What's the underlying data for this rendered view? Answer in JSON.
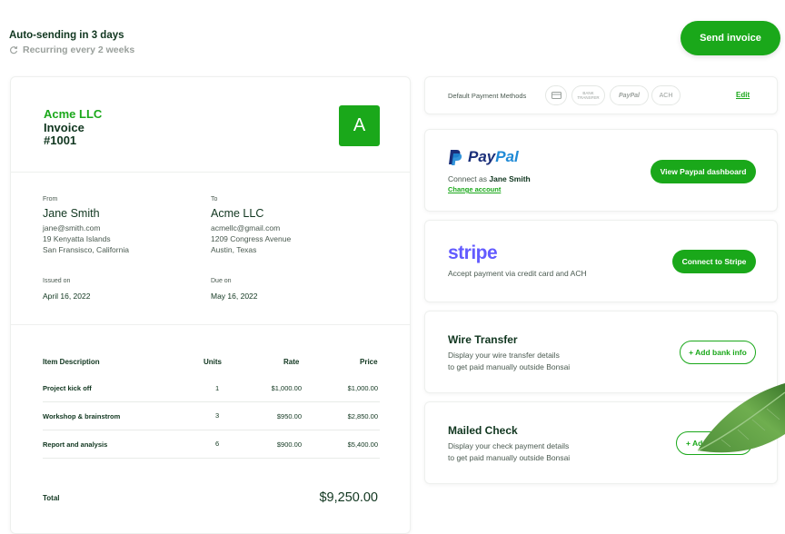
{
  "header": {
    "title": "Auto-sending in 3 days",
    "subtitle": "Recurring every 2 weeks",
    "send_button": "Send invoice"
  },
  "invoice": {
    "company": "Acme LLC",
    "label": "Invoice",
    "number": "#1001",
    "logo_letter": "A",
    "from": {
      "label": "From",
      "name": "Jane Smith",
      "email": "jane@smith.com",
      "address1": "19 Kenyatta Islands",
      "address2": "San Fransisco, California"
    },
    "to": {
      "label": "To",
      "name": "Acme LLC",
      "email": "acmellc@gmail.com",
      "address1": "1209 Congress Avenue",
      "address2": "Austin, Texas"
    },
    "issued": {
      "label": "Issued on",
      "date": "April 16, 2022"
    },
    "due": {
      "label": "Due on",
      "date": "May 16, 2022"
    },
    "table": {
      "headers": [
        "Item Description",
        "Units",
        "Rate",
        "Price"
      ],
      "rows": [
        {
          "description": "Project kick off",
          "units": "1",
          "rate": "$1,000.00",
          "price": "$1,000.00"
        },
        {
          "description": "Workshop & brainstrom",
          "units": "3",
          "rate": "$950.00",
          "price": "$2,850.00"
        },
        {
          "description": "Report and analysis",
          "units": "6",
          "rate": "$900.00",
          "price": "$5,400.00"
        }
      ]
    },
    "total_label": "Total",
    "total_value": "$9,250.00"
  },
  "payment_methods": {
    "label": "Default Payment Methods",
    "chips": [
      "card-icon",
      "BANK TRANSFER",
      "PayPal",
      "ACH"
    ],
    "edit": "Edit"
  },
  "paypal": {
    "brand_a": "Pay",
    "brand_b": "Pal",
    "connect_prefix": "Connect as ",
    "connect_name": "Jane Smith",
    "change": "Change account",
    "button": "View Paypal dashboard"
  },
  "stripe": {
    "brand": "stripe",
    "desc": "Accept payment via credit card and ACH",
    "button": "Connect to Stripe"
  },
  "wire": {
    "title": "Wire Transfer",
    "desc1": "Display your wire transfer details",
    "desc2": "to get paid manually outside Bonsai",
    "button": "+ Add bank info"
  },
  "check": {
    "title": "Mailed Check",
    "desc1": "Display your check payment details",
    "desc2": "to get paid manually outside Bonsai",
    "button": "+ Add"
  },
  "colors": {
    "accent": "#1aa81a",
    "dark": "#10361f",
    "paypal_dark": "#1a2f7a",
    "paypal_light": "#1f8ad6",
    "stripe": "#635bff"
  }
}
